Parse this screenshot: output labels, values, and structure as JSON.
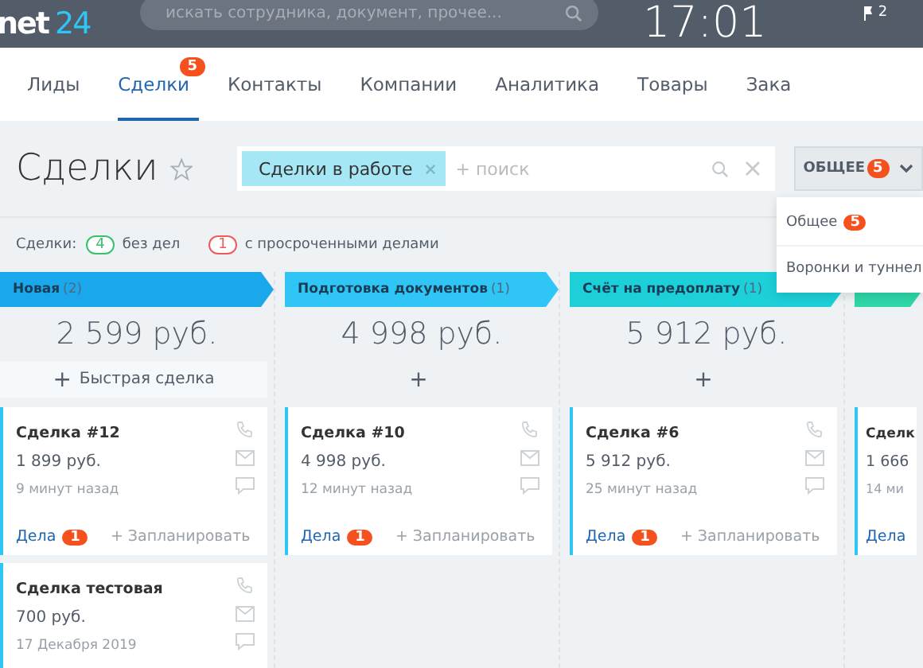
{
  "topbar": {
    "logo": "net",
    "logo_suffix": "24",
    "search_placeholder": "искать сотрудника, документ, прочее...",
    "clock": "17:01",
    "notifications": "2"
  },
  "nav_tabs": [
    {
      "label": "Лиды",
      "selected": false
    },
    {
      "label": "Сделки",
      "selected": true,
      "badge": "5"
    },
    {
      "label": "Контакты",
      "selected": false
    },
    {
      "label": "Компании",
      "selected": false
    },
    {
      "label": "Аналитика",
      "selected": false
    },
    {
      "label": "Товары",
      "selected": false
    },
    {
      "label": "Зака",
      "selected": false
    }
  ],
  "toolbar": {
    "title": "Сделки",
    "filter_chip": "Сделки в работе",
    "search_placeholder": "+ поиск",
    "category_button": "ОБЩЕЕ",
    "category_badge": "5"
  },
  "category_menu": [
    {
      "label": "Общее",
      "badge": "5"
    },
    {
      "label": "Воронки и туннел"
    }
  ],
  "counters": {
    "label": "Сделки:",
    "items": [
      {
        "count": "4",
        "text": "без дел",
        "color": "#3bc16c"
      },
      {
        "count": "1",
        "text": "с просроченными делами",
        "color": "#f05a5a"
      }
    ]
  },
  "columns": [
    {
      "title": "Новая",
      "count": "(2)",
      "color": "#1aa7ec",
      "total": "2 599 руб.",
      "add_icon": "+",
      "add_label": "Быстрая сделка",
      "cards": [
        {
          "title": "Сделка #12",
          "amount": "1 899 руб.",
          "time": "9 минут назад",
          "tasks_label": "Дела",
          "tasks_count": "1",
          "plan_label": "+ Запланировать"
        },
        {
          "title": "Сделка тестовая",
          "amount": "700 руб.",
          "time": "17 Декабря 2019"
        }
      ]
    },
    {
      "title": "Подготовка документов",
      "count": "(1)",
      "color": "#2fc6f6",
      "total": "4 998 руб.",
      "add_icon": "+",
      "cards": [
        {
          "title": "Сделка #10",
          "amount": "4 998 руб.",
          "time": "12 минут назад",
          "tasks_label": "Дела",
          "tasks_count": "1",
          "plan_label": "+ Запланировать"
        }
      ]
    },
    {
      "title": "Счёт на предоплату",
      "count": "(1)",
      "color": "#1ccfd8",
      "total": "5 912 руб.",
      "add_icon": "+",
      "cards": [
        {
          "title": "Сделка #6",
          "amount": "5 912 руб.",
          "time": "25 минут назад",
          "tasks_label": "Дела",
          "tasks_count": "1",
          "plan_label": "+ Запланировать"
        }
      ]
    },
    {
      "color": "#2fd6a8",
      "cards": [
        {
          "title": "Сделк",
          "amount": "1 666",
          "time": "14 ми",
          "tasks_label": "Дела"
        }
      ]
    }
  ]
}
